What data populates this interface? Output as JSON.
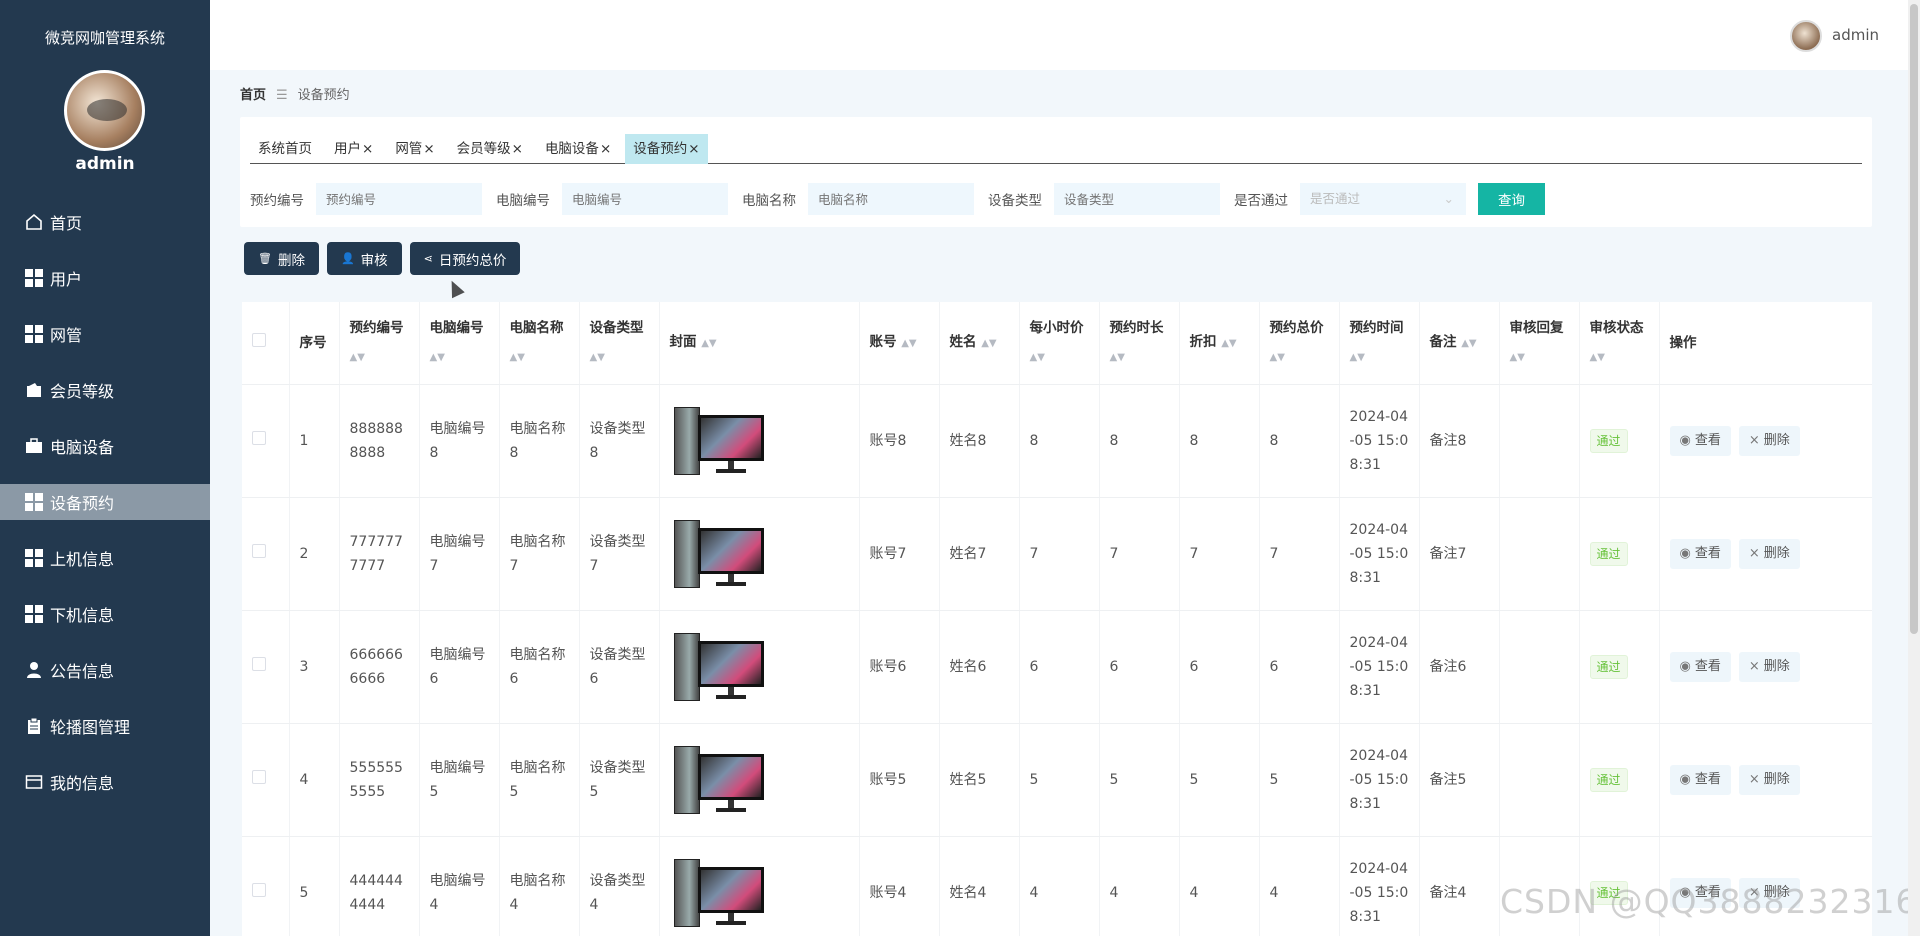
{
  "app": {
    "title": "微竞网咖管理系统",
    "username": "admin"
  },
  "sidebar": {
    "items": [
      {
        "label": "首页",
        "icon": "home-icon"
      },
      {
        "label": "用户",
        "icon": "grid-icon"
      },
      {
        "label": "网管",
        "icon": "grid-icon"
      },
      {
        "label": "会员等级",
        "icon": "wallet-icon"
      },
      {
        "label": "电脑设备",
        "icon": "briefcase-icon"
      },
      {
        "label": "设备预约",
        "icon": "grid-icon",
        "active": true
      },
      {
        "label": "上机信息",
        "icon": "grid-icon"
      },
      {
        "label": "下机信息",
        "icon": "grid-icon"
      },
      {
        "label": "公告信息",
        "icon": "user-icon"
      },
      {
        "label": "轮播图管理",
        "icon": "clipboard-icon"
      },
      {
        "label": "我的信息",
        "icon": "card-icon"
      }
    ]
  },
  "header": {
    "username": "admin"
  },
  "breadcrumb": {
    "home": "首页",
    "separator": "☰",
    "current": "设备预约"
  },
  "tabs": [
    {
      "label": "系统首页",
      "closable": false
    },
    {
      "label": "用户",
      "closable": true
    },
    {
      "label": "网管",
      "closable": true
    },
    {
      "label": "会员等级",
      "closable": true
    },
    {
      "label": "电脑设备",
      "closable": true
    },
    {
      "label": "设备预约",
      "closable": true,
      "active": true
    }
  ],
  "filters": [
    {
      "label": "预约编号",
      "placeholder": "预约编号"
    },
    {
      "label": "电脑编号",
      "placeholder": "电脑编号"
    },
    {
      "label": "电脑名称",
      "placeholder": "电脑名称"
    },
    {
      "label": "设备类型",
      "placeholder": "设备类型"
    }
  ],
  "filter_select": {
    "label": "是否通过",
    "placeholder": "是否通过"
  },
  "query_button": "查询",
  "actions": {
    "delete": "删除",
    "review": "审核",
    "daily_total": "日预约总价"
  },
  "table": {
    "columns": [
      "序号",
      "预约编号",
      "电脑编号",
      "电脑名称",
      "设备类型",
      "封面",
      "账号",
      "姓名",
      "每小时价",
      "预约时长",
      "折扣",
      "预约总价",
      "预约时间",
      "备注",
      "审核回复",
      "审核状态",
      "操作"
    ],
    "rows": [
      {
        "idx": "1",
        "code": "8888888888",
        "pc_no": "电脑编号8",
        "pc_name": "电脑名称8",
        "type": "设备类型8",
        "account": "账号8",
        "name": "姓名8",
        "price": "8",
        "duration": "8",
        "discount": "8",
        "total": "8",
        "time": "2024-04-05 15:08:31",
        "note": "备注8",
        "reply": "",
        "status": "通过"
      },
      {
        "idx": "2",
        "code": "7777777777",
        "pc_no": "电脑编号7",
        "pc_name": "电脑名称7",
        "type": "设备类型7",
        "account": "账号7",
        "name": "姓名7",
        "price": "7",
        "duration": "7",
        "discount": "7",
        "total": "7",
        "time": "2024-04-05 15:08:31",
        "note": "备注7",
        "reply": "",
        "status": "通过"
      },
      {
        "idx": "3",
        "code": "6666666666",
        "pc_no": "电脑编号6",
        "pc_name": "电脑名称6",
        "type": "设备类型6",
        "account": "账号6",
        "name": "姓名6",
        "price": "6",
        "duration": "6",
        "discount": "6",
        "total": "6",
        "time": "2024-04-05 15:08:31",
        "note": "备注6",
        "reply": "",
        "status": "通过"
      },
      {
        "idx": "4",
        "code": "5555555555",
        "pc_no": "电脑编号5",
        "pc_name": "电脑名称5",
        "type": "设备类型5",
        "account": "账号5",
        "name": "姓名5",
        "price": "5",
        "duration": "5",
        "discount": "5",
        "total": "5",
        "time": "2024-04-05 15:08:31",
        "note": "备注5",
        "reply": "",
        "status": "通过"
      },
      {
        "idx": "5",
        "code": "4444444444",
        "pc_no": "电脑编号4",
        "pc_name": "电脑名称4",
        "type": "设备类型4",
        "account": "账号4",
        "name": "姓名4",
        "price": "4",
        "duration": "4",
        "discount": "4",
        "total": "4",
        "time": "2024-04-05 15:08:31",
        "note": "备注4",
        "reply": "",
        "status": "通过"
      }
    ],
    "row_actions": {
      "view": "查看",
      "delete": "删除"
    }
  },
  "watermark": "CSDN @QQ3888232316",
  "colors": {
    "sidebar": "#23394f",
    "accent": "#15b5a4",
    "active_tab": "#bfe8f0",
    "status_ok": "#67c23a"
  }
}
